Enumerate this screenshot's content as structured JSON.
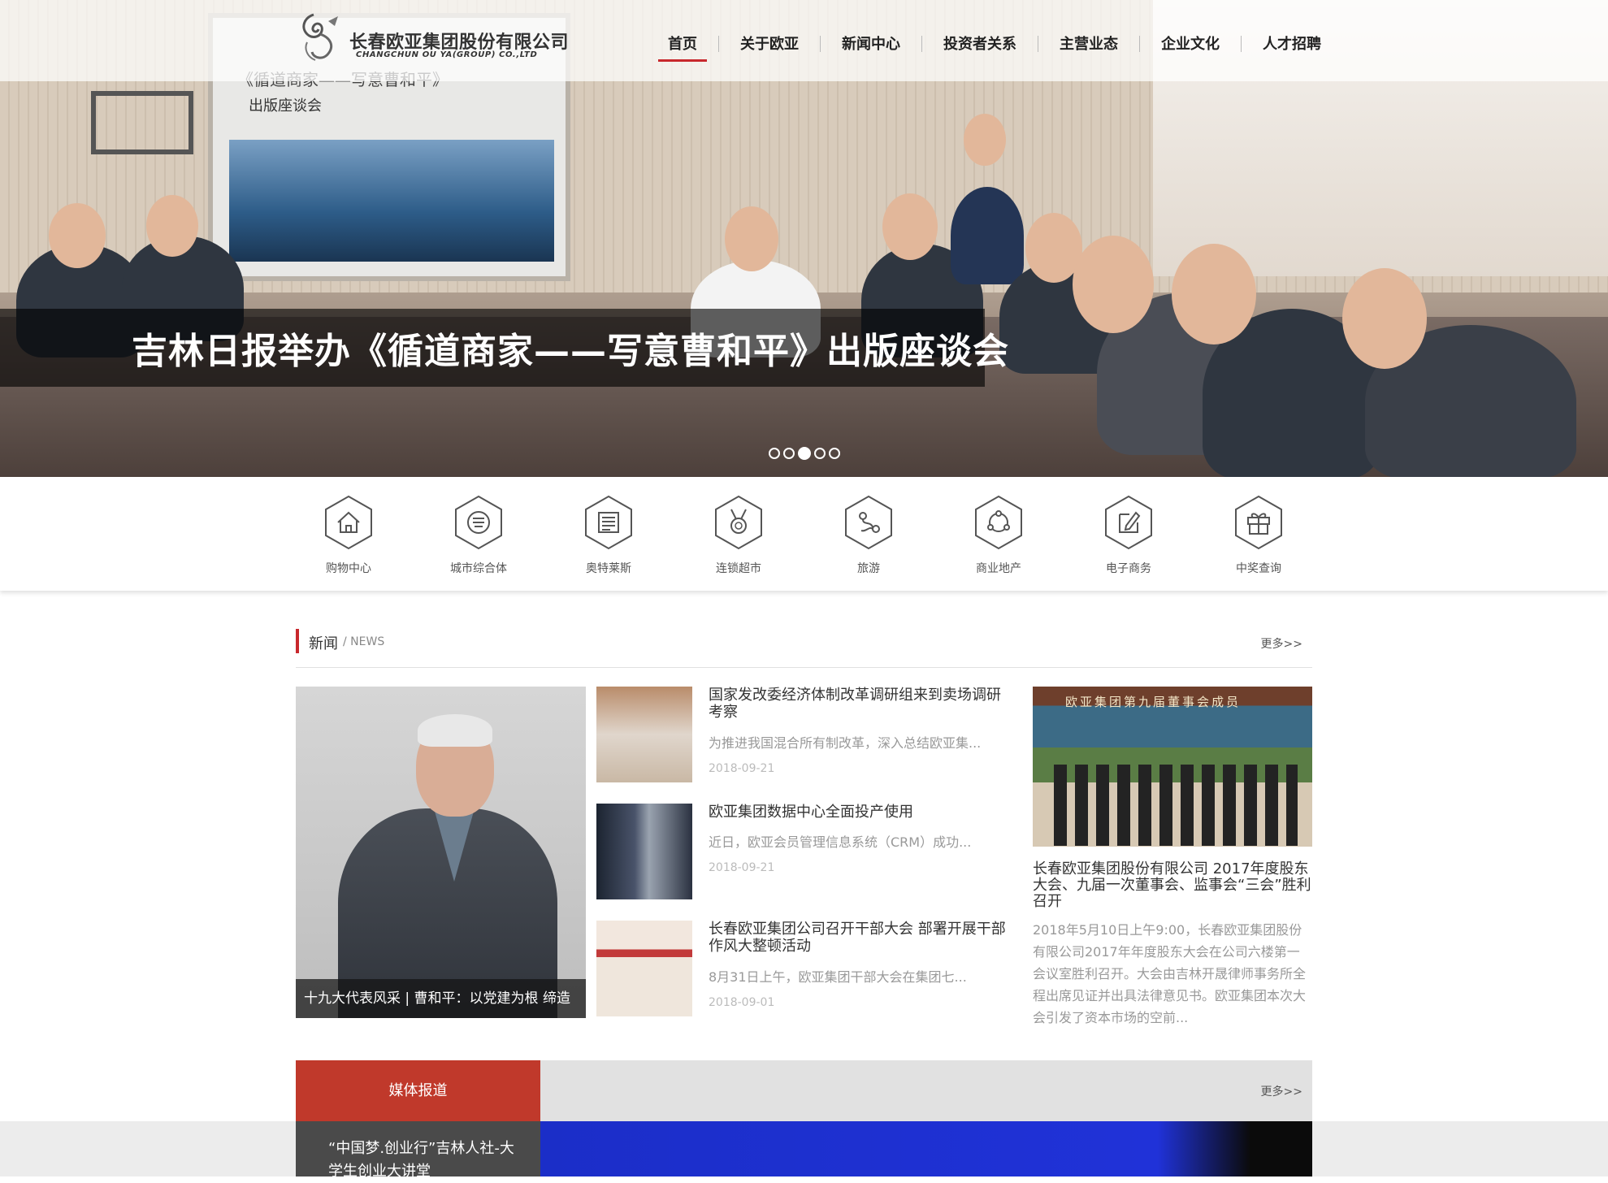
{
  "header": {
    "company_cn": "长春欧亚集团股份有限公司",
    "company_en": "CHANGCHUN OU YA(GROUP) CO.,LTD",
    "nav": [
      "首页",
      "关于欧亚",
      "新闻中心",
      "投资者关系",
      "主营业态",
      "企业文化",
      "人才招聘"
    ],
    "active_nav": "首页"
  },
  "hero": {
    "caption": "吉林日报举办《循道商家——写意曹和平》出版座谈会",
    "screen_title": "《循道商家——写意曹和平》",
    "screen_sub": "出版座谈会",
    "slide_count": 5,
    "active_slide": 3
  },
  "categories": [
    {
      "label": "购物中心",
      "icon": "house-icon"
    },
    {
      "label": "城市综合体",
      "icon": "complex-icon"
    },
    {
      "label": "奥特莱斯",
      "icon": "document-icon"
    },
    {
      "label": "连锁超市",
      "icon": "medal-icon"
    },
    {
      "label": "旅游",
      "icon": "route-icon"
    },
    {
      "label": "商业地产",
      "icon": "network-icon"
    },
    {
      "label": "电子商务",
      "icon": "edit-icon"
    },
    {
      "label": "中奖查询",
      "icon": "gift-icon"
    }
  ],
  "news": {
    "title": "新闻",
    "subtitle": "/ NEWS",
    "more": "更多>>",
    "feature_caption": "十九大代表风采 | 曹和平：以党建为根 缔造",
    "items": [
      {
        "title": "国家发改委经济体制改革调研组来到卖场调研考察",
        "desc": "为推进我国混合所有制改革，深入总结欧亚集...",
        "date": "2018-09-21"
      },
      {
        "title": "欧亚集团数据中心全面投产使用",
        "desc": "近日，欧亚会员管理信息系统（CRM）成功...",
        "date": "2018-09-21"
      },
      {
        "title": "长春欧亚集团公司召开干部大会 部署开展干部作风大整顿活动",
        "desc": "8月31日上午，欧亚集团干部大会在集团七...",
        "date": "2018-09-01"
      }
    ],
    "side": {
      "banner": "欧亚集团第九届董事会成员",
      "title": "长春欧亚集团股份有限公司 2017年度股东大会、九届一次董事会、监事会“三会”胜利召开",
      "desc": "2018年5月10日上午9:00，长春欧亚集团股份有限公司2017年年度股东大会在公司六楼第一会议室胜利召开。大会由吉林开晟律师事务所全程出席见证并出具法律意见书。欧亚集团本次大会引发了资本市场的空前..."
    }
  },
  "media": {
    "tab": "媒体报道",
    "more": "更多>>",
    "item": "“中国梦.创业行”吉林人社-大学生创业大讲堂"
  },
  "colors": {
    "accent": "#c8282d",
    "media_tab": "#c0392b"
  }
}
